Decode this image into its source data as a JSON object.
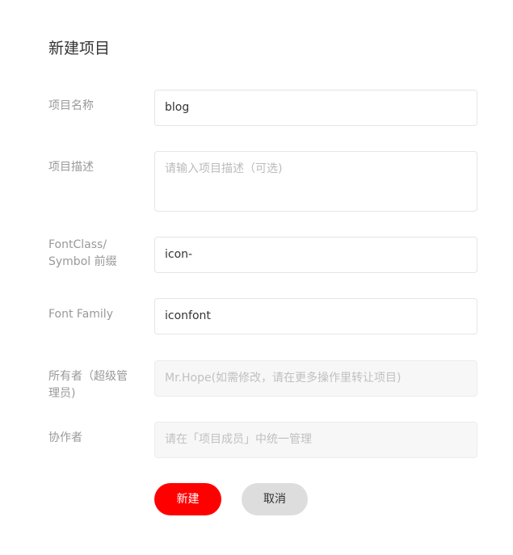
{
  "form": {
    "title": "新建项目",
    "fields": {
      "name": {
        "label": "项目名称",
        "value": "blog"
      },
      "description": {
        "label": "项目描述",
        "placeholder": "请输入项目描述（可选)"
      },
      "prefix": {
        "label_line1": "FontClass/",
        "label_line2": "Symbol 前缀",
        "value": "icon-"
      },
      "font_family": {
        "label": "Font Family",
        "value": "iconfont"
      },
      "owner": {
        "label": "所有者（超级管理员)",
        "value": "Mr.Hope(如需修改，请在更多操作里转让项目)"
      },
      "collaborators": {
        "label": "协作者",
        "placeholder": "请在「项目成员」中统一管理"
      }
    },
    "buttons": {
      "create": "新建",
      "cancel": "取消"
    }
  },
  "colors": {
    "primary": "#ff0000",
    "secondary_button": "#dddddd",
    "label": "#999999",
    "border": "#e5e5e5"
  }
}
